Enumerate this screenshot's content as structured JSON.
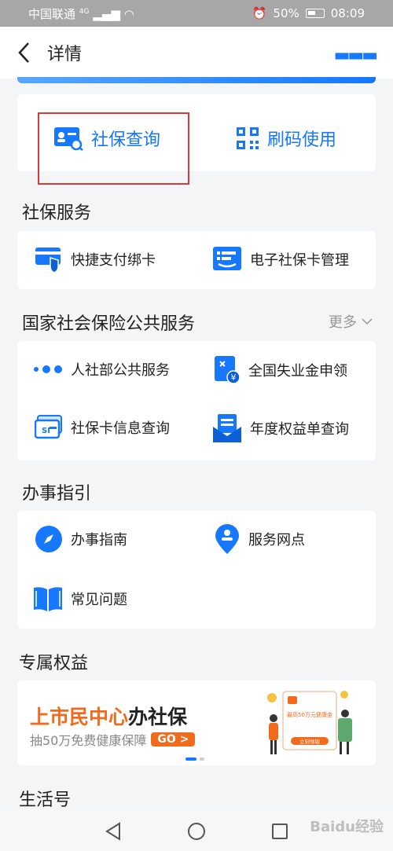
{
  "status_bar": {
    "carrier": "中国联通",
    "network": "4G",
    "battery": "50%",
    "time": "08:09"
  },
  "nav": {
    "title": "详情",
    "more_icon": "more-dots-icon"
  },
  "top_actions": [
    {
      "label": "社保查询",
      "icon": "id-card-search-icon"
    },
    {
      "label": "刷码使用",
      "icon": "qr-code-icon"
    }
  ],
  "sections": {
    "social_security": {
      "title": "社保服务",
      "items": [
        {
          "label": "快捷支付绑卡",
          "icon": "card-shield-icon"
        },
        {
          "label": "电子社保卡管理",
          "icon": "e-card-icon"
        }
      ]
    },
    "national": {
      "title": "国家社会保险公共服务",
      "more": "更多",
      "items": [
        {
          "label": "人社部公共服务",
          "icon": "three-dots-icon"
        },
        {
          "label": "全国失业金申领",
          "icon": "yuan-document-icon"
        },
        {
          "label": "社保卡信息查询",
          "icon": "si-card-icon"
        },
        {
          "label": "年度权益单查询",
          "icon": "envelope-document-icon"
        }
      ]
    },
    "guide": {
      "title": "办事指引",
      "items": [
        {
          "label": "办事指南",
          "icon": "compass-icon"
        },
        {
          "label": "服务网点",
          "icon": "location-pin-icon"
        },
        {
          "label": "常见问题",
          "icon": "open-book-icon"
        }
      ]
    },
    "benefits": {
      "title": "专属权益",
      "banner": {
        "title_orange": "上市民中心",
        "title_dark": "办社保",
        "subtitle": "抽50万免费健康保障",
        "go": "GO >",
        "illustration_caption": "最高50万元健康金",
        "illustration_button": "立刻领取"
      }
    },
    "life": {
      "title": "生活号"
    }
  },
  "watermark": "Baidu经验",
  "colors": {
    "accent": "#1677ff",
    "orange": "#f26b1d",
    "highlight_box": "#d9393b"
  }
}
